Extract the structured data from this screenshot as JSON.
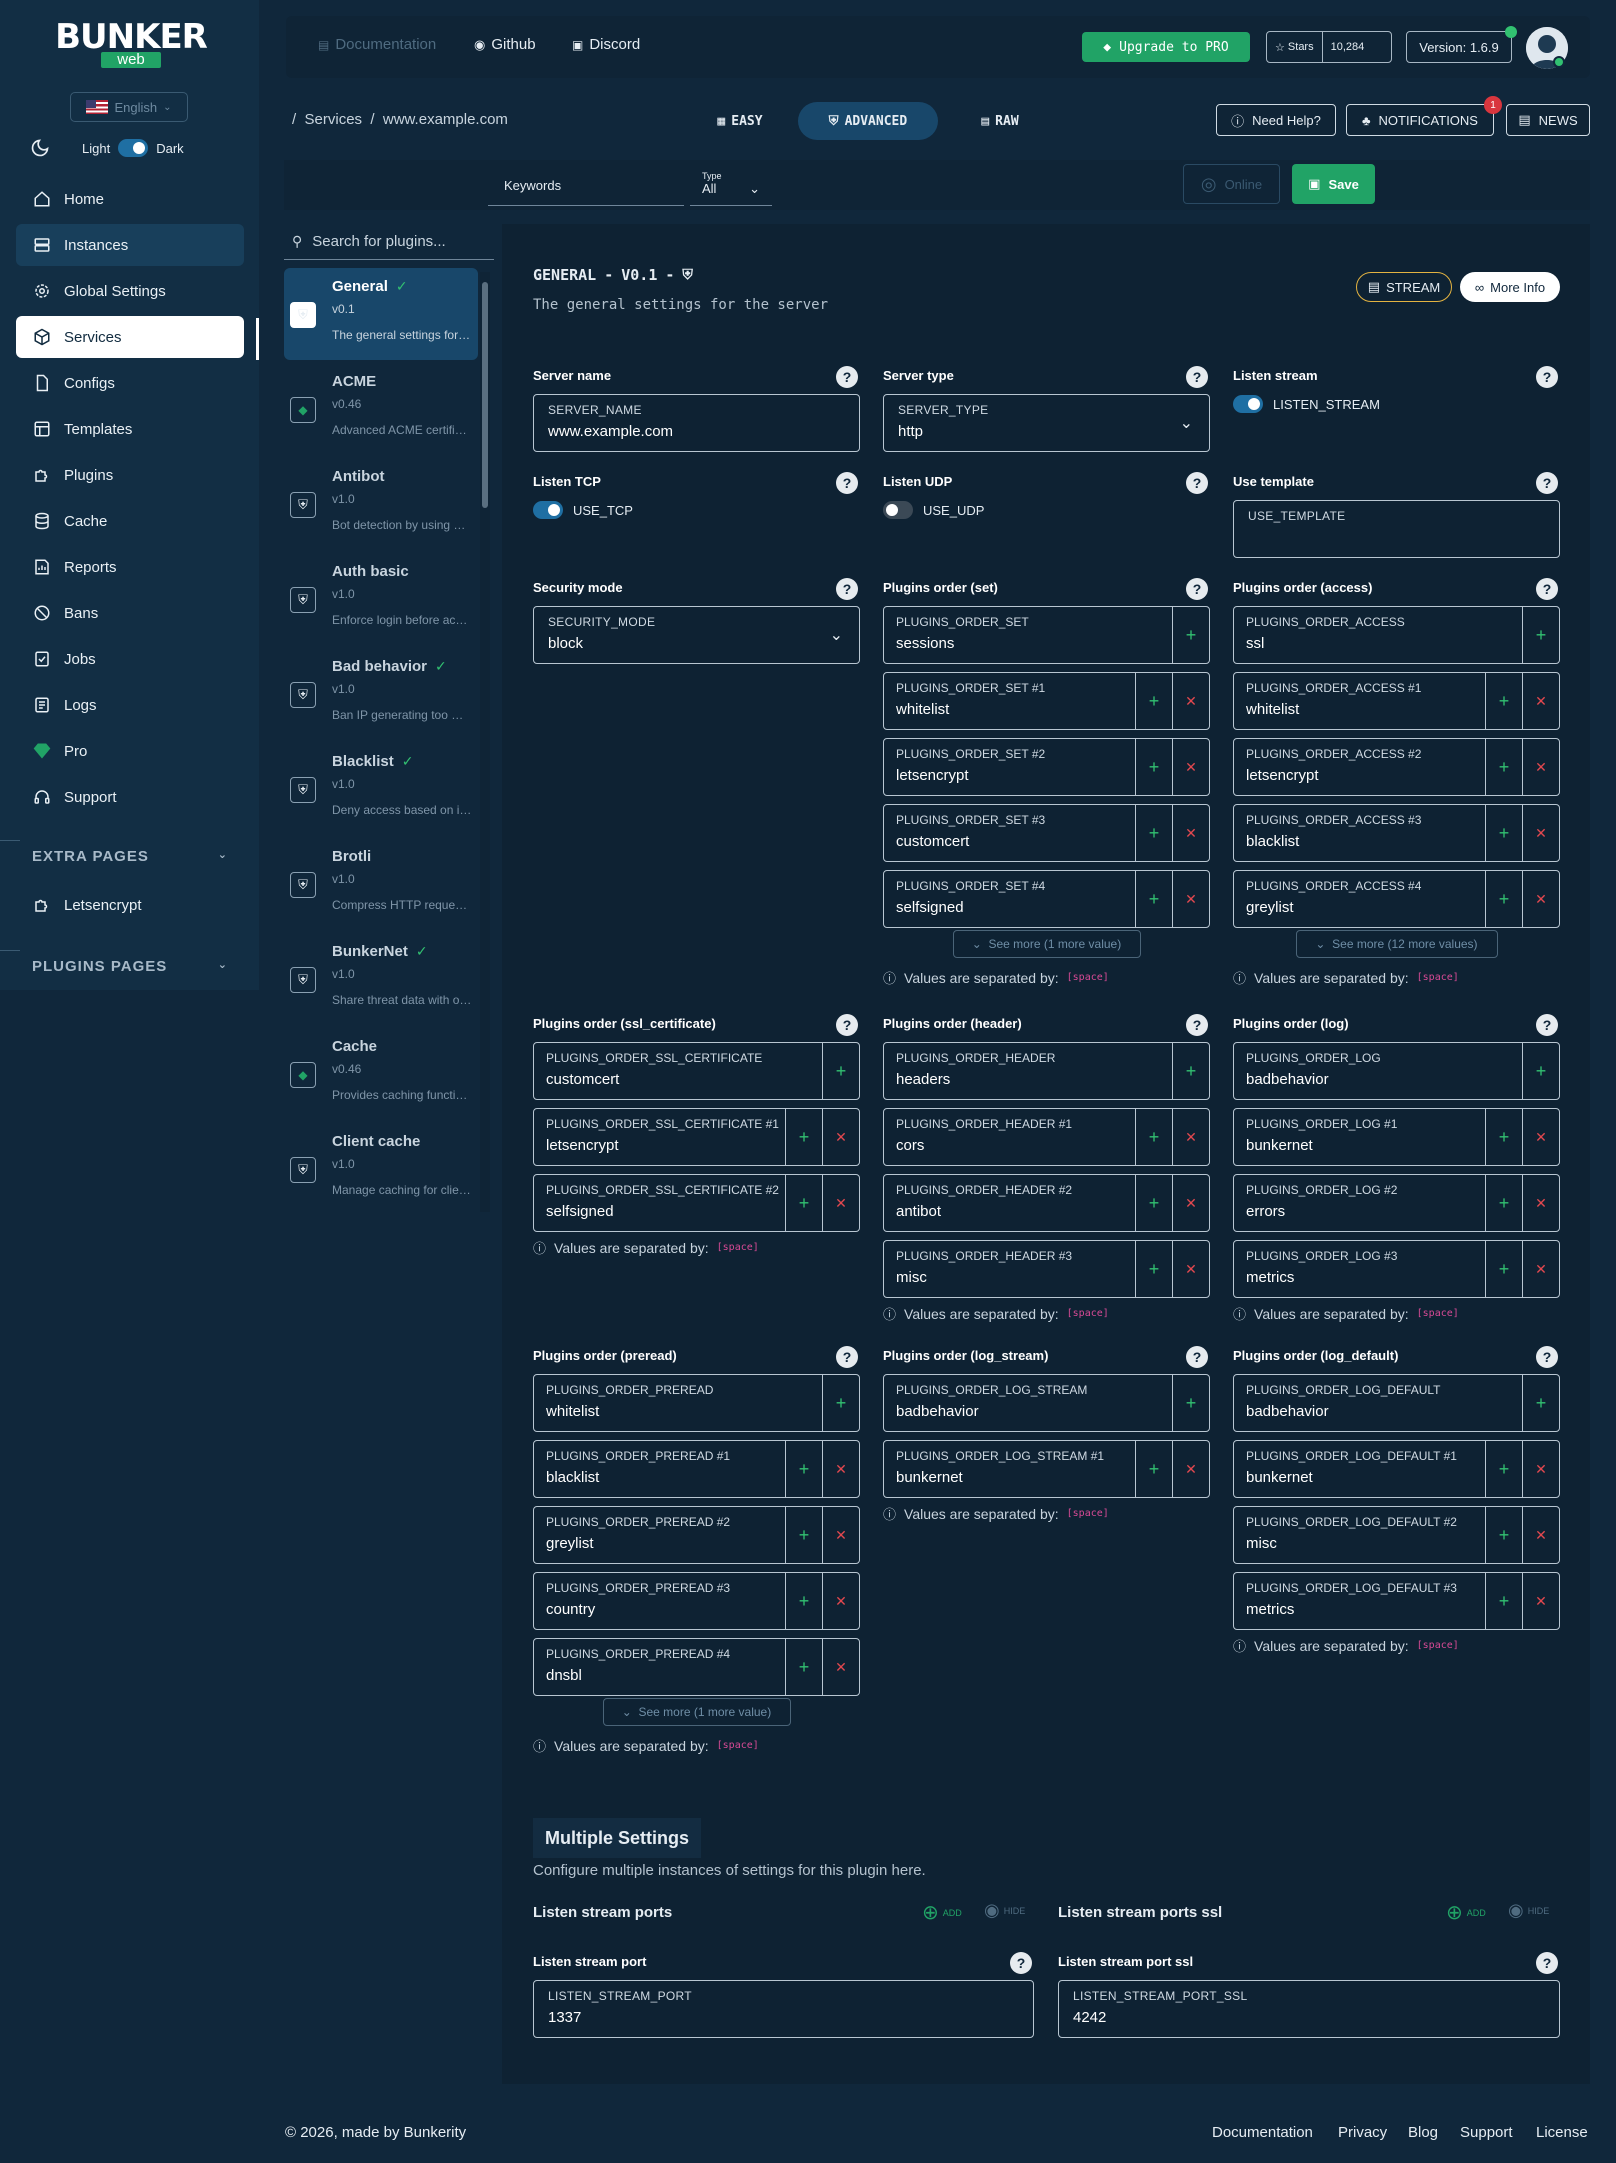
{
  "brand": {
    "name": "BUNKER",
    "sub": "web"
  },
  "sidebar": {
    "language": "English",
    "theme": {
      "light": "Light",
      "dark": "Dark"
    },
    "items": [
      {
        "label": "Home",
        "icon": "home-icon"
      },
      {
        "label": "Instances",
        "icon": "server-icon"
      },
      {
        "label": "Global Settings",
        "icon": "gear-icon"
      },
      {
        "label": "Services",
        "icon": "box-icon"
      },
      {
        "label": "Configs",
        "icon": "file-icon"
      },
      {
        "label": "Templates",
        "icon": "template-icon"
      },
      {
        "label": "Plugins",
        "icon": "puzzle-icon"
      },
      {
        "label": "Cache",
        "icon": "database-icon"
      },
      {
        "label": "Reports",
        "icon": "report-icon"
      },
      {
        "label": "Bans",
        "icon": "ban-icon"
      },
      {
        "label": "Jobs",
        "icon": "jobs-icon"
      },
      {
        "label": "Logs",
        "icon": "logs-icon"
      },
      {
        "label": "Pro",
        "icon": "diamond-icon"
      },
      {
        "label": "Support",
        "icon": "headset-icon"
      }
    ],
    "extra_pages": "EXTRA PAGES",
    "extra_items": [
      {
        "label": "Letsencrypt"
      }
    ],
    "plugins_pages": "PLUGINS PAGES"
  },
  "topbar": {
    "documentation": "Documentation",
    "github": "Github",
    "discord": "Discord",
    "upgrade": "Upgrade to PRO",
    "stars_label": "Stars",
    "stars_count": "10,284",
    "version": "Version: 1.6.9"
  },
  "subbar": {
    "breadcrumb": [
      "Services",
      "www.example.com"
    ],
    "modes": [
      "EASY",
      "ADVANCED",
      "RAW"
    ],
    "need_help": "Need Help?",
    "notifications": "NOTIFICATIONS",
    "notif_count": "1",
    "news": "NEWS"
  },
  "filter": {
    "keywords": "Keywords",
    "type_label": "Type",
    "type_value": "All",
    "online": "Online",
    "save": "Save"
  },
  "plugin_list": {
    "search_placeholder": "Search for plugins...",
    "items": [
      {
        "name": "General",
        "version": "v0.1",
        "desc": "The general settings for the server",
        "verified": true
      },
      {
        "name": "ACME",
        "version": "v0.46",
        "desc": "Advanced ACME certificate management",
        "verified": false
      },
      {
        "name": "Antibot",
        "version": "v1.0",
        "desc": "Bot detection by using a challenge",
        "verified": false
      },
      {
        "name": "Auth basic",
        "version": "v1.0",
        "desc": "Enforce login before accessing",
        "verified": false
      },
      {
        "name": "Bad behavior",
        "version": "v1.0",
        "desc": "Ban IP generating too much errors",
        "verified": true
      },
      {
        "name": "Blacklist",
        "version": "v1.0",
        "desc": "Deny access based on internal",
        "verified": true
      },
      {
        "name": "Brotli",
        "version": "v1.0",
        "desc": "Compress HTTP requests with brotli",
        "verified": false
      },
      {
        "name": "BunkerNet",
        "version": "v1.0",
        "desc": "Share threat data with other",
        "verified": true
      },
      {
        "name": "Cache",
        "version": "v0.46",
        "desc": "Provides caching functionality",
        "verified": false
      },
      {
        "name": "Client cache",
        "version": "v1.0",
        "desc": "Manage caching for clients",
        "verified": false
      }
    ]
  },
  "panel": {
    "title": "GENERAL",
    "version": "V0.1",
    "subtitle": "The general settings for the server",
    "stream": "STREAM",
    "more_info": "More Info",
    "sep_text": "Values are separated by:",
    "sep_tag": "[space]",
    "server_name": {
      "label": "Server name",
      "key": "SERVER_NAME",
      "value": "www.example.com"
    },
    "server_type": {
      "label": "Server type",
      "key": "SERVER_TYPE",
      "value": "http"
    },
    "listen_stream": {
      "label": "Listen stream",
      "key": "LISTEN_STREAM"
    },
    "listen_tcp": {
      "label": "Listen TCP",
      "key": "USE_TCP"
    },
    "listen_udp": {
      "label": "Listen UDP",
      "key": "USE_UDP"
    },
    "use_template": {
      "label": "Use template",
      "key": "USE_TEMPLATE",
      "value": ""
    },
    "security_mode": {
      "label": "Security mode",
      "key": "SECURITY_MODE",
      "value": "block"
    },
    "order_set": {
      "label": "Plugins order (set)",
      "rows": [
        [
          "PLUGINS_ORDER_SET",
          "sessions"
        ],
        [
          "PLUGINS_ORDER_SET #1",
          "whitelist"
        ],
        [
          "PLUGINS_ORDER_SET #2",
          "letsencrypt"
        ],
        [
          "PLUGINS_ORDER_SET #3",
          "customcert"
        ],
        [
          "PLUGINS_ORDER_SET #4",
          "selfsigned"
        ]
      ],
      "see_more": "See more (1 more value)"
    },
    "order_access": {
      "label": "Plugins order (access)",
      "rows": [
        [
          "PLUGINS_ORDER_ACCESS",
          "ssl"
        ],
        [
          "PLUGINS_ORDER_ACCESS #1",
          "whitelist"
        ],
        [
          "PLUGINS_ORDER_ACCESS #2",
          "letsencrypt"
        ],
        [
          "PLUGINS_ORDER_ACCESS #3",
          "blacklist"
        ],
        [
          "PLUGINS_ORDER_ACCESS #4",
          "greylist"
        ]
      ],
      "see_more": "See more (12 more values)"
    },
    "order_ssl": {
      "label": "Plugins order (ssl_certificate)",
      "rows": [
        [
          "PLUGINS_ORDER_SSL_CERTIFICATE",
          "customcert"
        ],
        [
          "PLUGINS_ORDER_SSL_CERTIFICATE #1",
          "letsencrypt"
        ],
        [
          "PLUGINS_ORDER_SSL_CERTIFICATE #2",
          "selfsigned"
        ]
      ]
    },
    "order_header": {
      "label": "Plugins order (header)",
      "rows": [
        [
          "PLUGINS_ORDER_HEADER",
          "headers"
        ],
        [
          "PLUGINS_ORDER_HEADER #1",
          "cors"
        ],
        [
          "PLUGINS_ORDER_HEADER #2",
          "antibot"
        ],
        [
          "PLUGINS_ORDER_HEADER #3",
          "misc"
        ]
      ]
    },
    "order_log": {
      "label": "Plugins order (log)",
      "rows": [
        [
          "PLUGINS_ORDER_LOG",
          "badbehavior"
        ],
        [
          "PLUGINS_ORDER_LOG #1",
          "bunkernet"
        ],
        [
          "PLUGINS_ORDER_LOG #2",
          "errors"
        ],
        [
          "PLUGINS_ORDER_LOG #3",
          "metrics"
        ]
      ]
    },
    "order_preread": {
      "label": "Plugins order (preread)",
      "rows": [
        [
          "PLUGINS_ORDER_PREREAD",
          "whitelist"
        ],
        [
          "PLUGINS_ORDER_PREREAD #1",
          "blacklist"
        ],
        [
          "PLUGINS_ORDER_PREREAD #2",
          "greylist"
        ],
        [
          "PLUGINS_ORDER_PREREAD #3",
          "country"
        ],
        [
          "PLUGINS_ORDER_PREREAD #4",
          "dnsbl"
        ]
      ],
      "see_more": "See more (1 more value)"
    },
    "order_log_stream": {
      "label": "Plugins order (log_stream)",
      "rows": [
        [
          "PLUGINS_ORDER_LOG_STREAM",
          "badbehavior"
        ],
        [
          "PLUGINS_ORDER_LOG_STREAM #1",
          "bunkernet"
        ]
      ]
    },
    "order_log_default": {
      "label": "Plugins order (log_default)",
      "rows": [
        [
          "PLUGINS_ORDER_LOG_DEFAULT",
          "badbehavior"
        ],
        [
          "PLUGINS_ORDER_LOG_DEFAULT #1",
          "bunkernet"
        ],
        [
          "PLUGINS_ORDER_LOG_DEFAULT #2",
          "misc"
        ],
        [
          "PLUGINS_ORDER_LOG_DEFAULT #3",
          "metrics"
        ]
      ]
    },
    "multiple": {
      "title": "Multiple Settings",
      "desc": "Configure multiple instances of settings for this plugin here.",
      "add": "ADD",
      "hide": "HIDE",
      "groups": [
        {
          "title": "Listen stream ports",
          "label": "Listen stream port",
          "key": "LISTEN_STREAM_PORT",
          "value": "1337"
        },
        {
          "title": "Listen stream ports ssl",
          "label": "Listen stream port ssl",
          "key": "LISTEN_STREAM_PORT_SSL",
          "value": "4242"
        }
      ]
    }
  },
  "footer": {
    "copyright": "© 2026, made by",
    "company": "Bunkerity",
    "links": [
      "Documentation",
      "Privacy",
      "Blog",
      "Support",
      "License"
    ]
  },
  "colors": {
    "accent": "#21a366",
    "bg": "#10273b",
    "danger": "#e2484f"
  }
}
